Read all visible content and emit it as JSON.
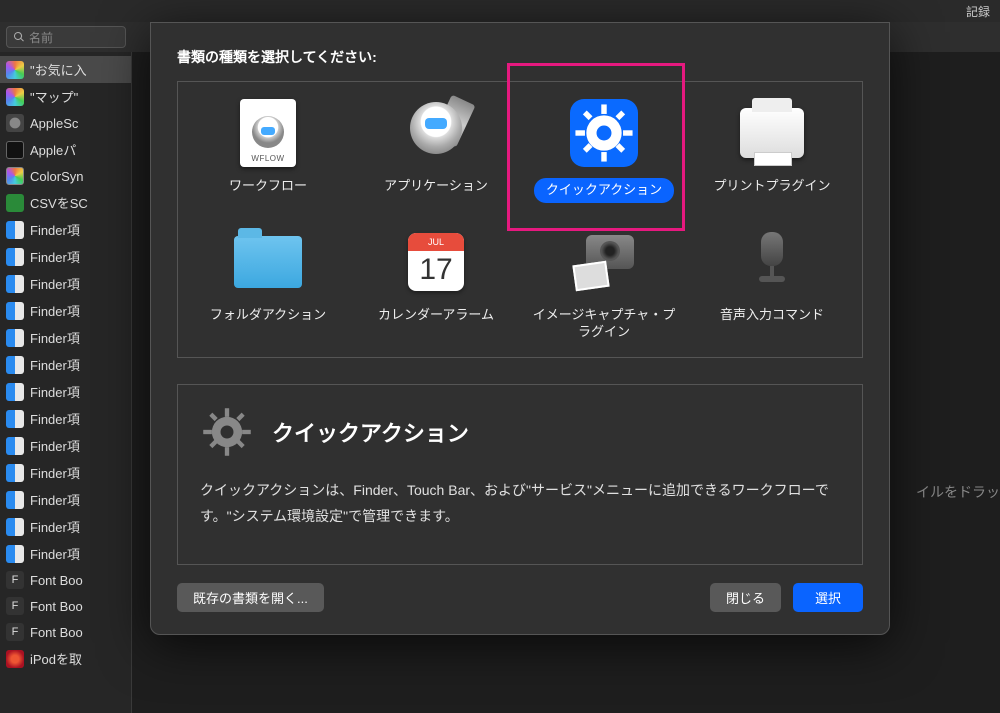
{
  "menubar": {
    "record": "記録"
  },
  "search": {
    "placeholder": "名前"
  },
  "sidebar": {
    "items": [
      {
        "label": "\"お気に入",
        "iconClass": "ic-fav"
      },
      {
        "label": "\"マップ\"",
        "iconClass": "ic-map"
      },
      {
        "label": "AppleSc",
        "iconClass": "ic-scr"
      },
      {
        "label": "Appleパ",
        "iconClass": "ic-term"
      },
      {
        "label": "ColorSyn",
        "iconClass": "ic-cs"
      },
      {
        "label": "CSVをSC",
        "iconClass": "ic-csv"
      },
      {
        "label": "Finder項",
        "iconClass": "ic-finder"
      },
      {
        "label": "Finder項",
        "iconClass": "ic-finder"
      },
      {
        "label": "Finder項",
        "iconClass": "ic-finder"
      },
      {
        "label": "Finder項",
        "iconClass": "ic-finder"
      },
      {
        "label": "Finder項",
        "iconClass": "ic-finder"
      },
      {
        "label": "Finder項",
        "iconClass": "ic-finder"
      },
      {
        "label": "Finder項",
        "iconClass": "ic-finder"
      },
      {
        "label": "Finder項",
        "iconClass": "ic-finder"
      },
      {
        "label": "Finder項",
        "iconClass": "ic-finder"
      },
      {
        "label": "Finder項",
        "iconClass": "ic-finder"
      },
      {
        "label": "Finder項",
        "iconClass": "ic-finder"
      },
      {
        "label": "Finder項",
        "iconClass": "ic-finder"
      },
      {
        "label": "Finder項",
        "iconClass": "ic-finder"
      },
      {
        "label": "Font Boo",
        "iconClass": "ic-font"
      },
      {
        "label": "Font Boo",
        "iconClass": "ic-font"
      },
      {
        "label": "Font Boo",
        "iconClass": "ic-font"
      },
      {
        "label": "iPodを取",
        "iconClass": "ic-itunes"
      }
    ]
  },
  "background": {
    "hint": "イルをドラッ"
  },
  "sheet": {
    "title": "書類の種類を選択してください:",
    "types": [
      {
        "key": "workflow",
        "label": "ワークフロー"
      },
      {
        "key": "application",
        "label": "アプリケーション"
      },
      {
        "key": "quickaction",
        "label": "クイックアクション",
        "selected": true,
        "highlighted": true
      },
      {
        "key": "printplugin",
        "label": "プリントプラグイン"
      },
      {
        "key": "folderaction",
        "label": "フォルダアクション"
      },
      {
        "key": "calendaralarm",
        "label": "カレンダーアラーム"
      },
      {
        "key": "imagecapture",
        "label": "イメージキャプチャ・プラグイン"
      },
      {
        "key": "dictation",
        "label": "音声入力コマンド"
      }
    ],
    "calendar": {
      "month": "JUL",
      "day": "17"
    },
    "wflow_badge": "WFLOW",
    "description": {
      "title": "クイックアクション",
      "body": "クイックアクションは、Finder、Touch Bar、および\"サービス\"メニューに追加できるワークフローです。\"システム環境設定\"で管理できます。"
    },
    "buttons": {
      "open": "既存の書類を開く...",
      "close": "閉じる",
      "choose": "選択"
    }
  }
}
